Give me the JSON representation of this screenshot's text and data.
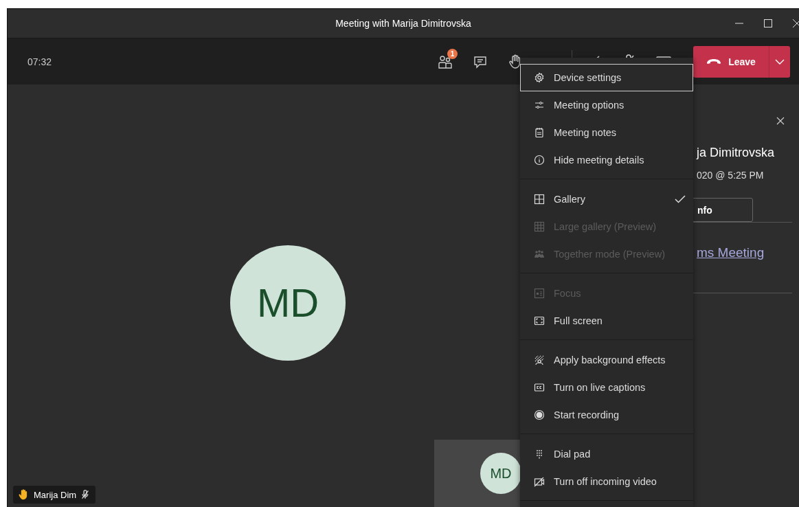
{
  "window": {
    "title": "Meeting with Marija Dimitrovska"
  },
  "toolbar": {
    "timer": "07:32",
    "participants_badge": "1",
    "leave_button": "Leave"
  },
  "stage": {
    "avatar_initials": "MD",
    "name_tag": {
      "name": "Marija Dim",
      "hand_raised": true,
      "muted": true
    },
    "self_view": {
      "initials": "MD"
    }
  },
  "details_panel": {
    "title": "ja Dimitrovska",
    "time": "020 @ 5:25 PM",
    "button": "nfo",
    "link": "ms Meeting"
  },
  "menu": {
    "groups": [
      [
        {
          "label": "Device settings",
          "focused": true,
          "disabled": false,
          "checked": false
        },
        {
          "label": "Meeting options",
          "focused": false,
          "disabled": false,
          "checked": false
        },
        {
          "label": "Meeting notes",
          "focused": false,
          "disabled": false,
          "checked": false
        },
        {
          "label": "Hide meeting details",
          "focused": false,
          "disabled": false,
          "checked": false
        }
      ],
      [
        {
          "label": "Gallery",
          "focused": false,
          "disabled": false,
          "checked": true
        },
        {
          "label": "Large gallery (Preview)",
          "focused": false,
          "disabled": true,
          "checked": false
        },
        {
          "label": "Together mode (Preview)",
          "focused": false,
          "disabled": true,
          "checked": false
        }
      ],
      [
        {
          "label": "Focus",
          "focused": false,
          "disabled": true,
          "checked": false
        },
        {
          "label": "Full screen",
          "focused": false,
          "disabled": false,
          "checked": false
        }
      ],
      [
        {
          "label": "Apply background effects",
          "focused": false,
          "disabled": false,
          "checked": false
        },
        {
          "label": "Turn on live captions",
          "focused": false,
          "disabled": false,
          "checked": false
        },
        {
          "label": "Start recording",
          "focused": false,
          "disabled": false,
          "checked": false
        }
      ],
      [
        {
          "label": "Dial pad",
          "focused": false,
          "disabled": false,
          "checked": false
        },
        {
          "label": "Turn off incoming video",
          "focused": false,
          "disabled": false,
          "checked": false
        }
      ]
    ]
  }
}
